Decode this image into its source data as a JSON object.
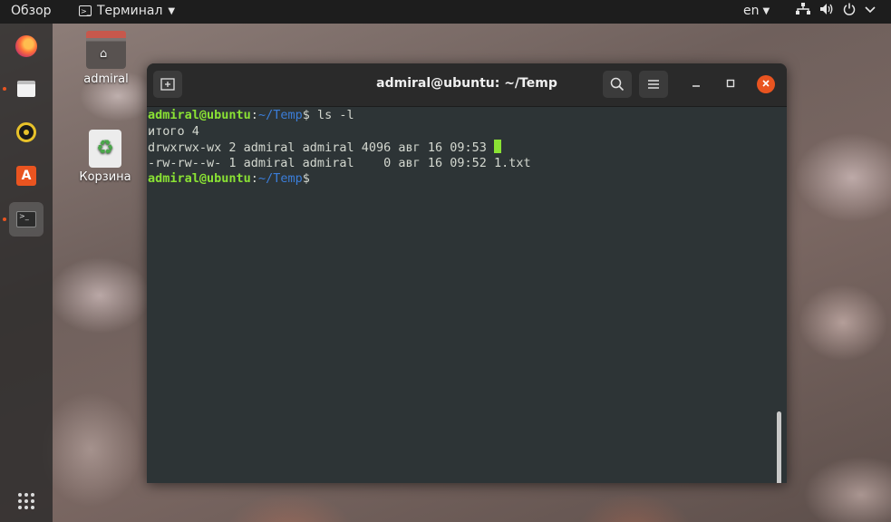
{
  "topbar": {
    "activities": "Обзор",
    "app_name": "Терминал",
    "app_menu_arrow": "▼",
    "language": "en",
    "language_arrow": "▼",
    "icons": [
      "network-icon",
      "volume-icon",
      "power-icon",
      "chevron-down-icon"
    ]
  },
  "dock": {
    "items": [
      {
        "name": "firefox",
        "icon": "firefox-icon"
      },
      {
        "name": "files",
        "icon": "files-icon"
      },
      {
        "name": "rhythmbox",
        "icon": "rhythmbox-icon"
      },
      {
        "name": "software",
        "icon": "software-center-icon"
      },
      {
        "name": "terminal",
        "icon": "terminal-icon",
        "active": true
      }
    ],
    "apps_grid_icon": "apps-grid-icon"
  },
  "desktop": {
    "home_label": "admiral",
    "trash_label": "Корзина"
  },
  "terminal": {
    "title": "admiral@ubuntu: ~/Temp",
    "colors": {
      "prompt_user": "#8ae234",
      "prompt_path": "#3b7dd8",
      "background": "#2d3436",
      "close": "#e95420"
    },
    "lines": {
      "l1_user": "admiral@ubuntu",
      "l1_colon": ":",
      "l1_path": "~/Temp",
      "l1_cmd": "$ ls -l",
      "l2": "итого 4",
      "l3": "drwxrwx-wx 2 admiral admiral 4096 авг 16 09:53 ",
      "l4": "-rw-rw--w- 1 admiral admiral    0 авг 16 09:52 1.txt",
      "l5_user": "admiral@ubuntu",
      "l5_colon": ":",
      "l5_path": "~/Temp",
      "l5_cmd": "$"
    }
  }
}
